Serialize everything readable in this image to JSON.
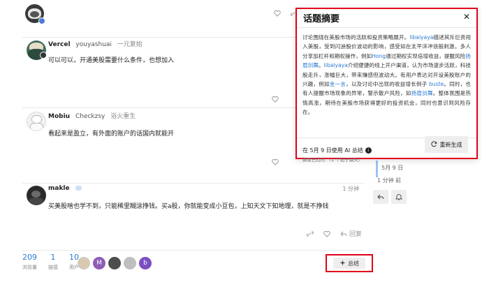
{
  "posts": [
    {
      "username": "Vercel",
      "fullname": "youyashuai",
      "user_title": "一元复始",
      "body": "可以可以，开通美股需要什么条件，也想加入"
    },
    {
      "username": "Mobiu",
      "fullname": "Checkzsy",
      "user_title": "浴火重生",
      "body": "看起来是盈立，有外面的账户的话国内就能开"
    },
    {
      "username": "makle",
      "time": "1 分钟",
      "body": "买美股啥也学不到，只能稀里糊涂挣钱。买a股，你就能变成小豆包，上知天文下知地理，就是不挣钱",
      "reply_label": "回复"
    }
  ],
  "stats": {
    "views": "209",
    "views_label": "浏览量",
    "links": "1",
    "links_label": "链接",
    "users": "10",
    "users_label": "用户"
  },
  "participants": [
    {
      "letter": "",
      "color": "#d9c9b0"
    },
    {
      "letter": "M",
      "color": "#8e5db5"
    },
    {
      "letter": "",
      "color": "#4d4d4d"
    },
    {
      "letter": "",
      "color": "#bfbfbf"
    },
    {
      "letter": "b",
      "color": "#7b4fc1"
    }
  ],
  "summarize_button": "总结",
  "timeline": {
    "date": "5月 9 日",
    "ago": "1 分钟 前"
  },
  "modal": {
    "title": "话题摘要",
    "body_parts": [
      {
        "text": "讨论围绕在美股市场的活跃和投资策略展开。",
        "mention": false
      },
      {
        "text": "libaiyaya",
        "mention": true
      },
      {
        "text": "描述其斥巨资闯入美股，受到闪迪股价波动的影响，感受如在太平洋冲浪般刺激。多人分享加杠杆和期权操作，例如",
        "mention": false
      },
      {
        "text": "Hong",
        "mention": true
      },
      {
        "text": "通过期权实现倍增收益，提醒风险",
        "mention": false
      },
      {
        "text": "扬眉剑舞",
        "mention": true
      },
      {
        "text": "。",
        "mention": false
      },
      {
        "text": "libaiyaya",
        "mention": true
      },
      {
        "text": "介绍便捷的线上开户渠道，认为市场逐步活跃，科技股走升，涨幅巨大，带来赚感但波动大。有用户表达对开设美股账户的兴趣，例如",
        "mention": false
      },
      {
        "text": "金一言",
        "mention": true
      },
      {
        "text": "，以及讨论中出现的收益增长例子 ",
        "mention": false
      },
      {
        "text": "buste",
        "mention": true
      },
      {
        "text": "。同时，也有人提醒市场现象的异常，警示散户风险，如",
        "mention": false
      },
      {
        "text": "扬眉剑舞",
        "mention": true
      },
      {
        "text": "。整体氛围是热情高涨，期待在美股市场获得更好的投资机会，同时也意识到风险存在。",
        "mention": false
      }
    ],
    "footer_line1": "在 5月 9 日使用 AI 总结",
    "footer_line2": "摘要已过时 （1 个帖子缺失）",
    "regenerate_label": "重新生成"
  },
  "colors": {
    "accent": "#2a7ad6",
    "highlight_border": "#e3001b",
    "button_bg": "#eeeeee"
  }
}
